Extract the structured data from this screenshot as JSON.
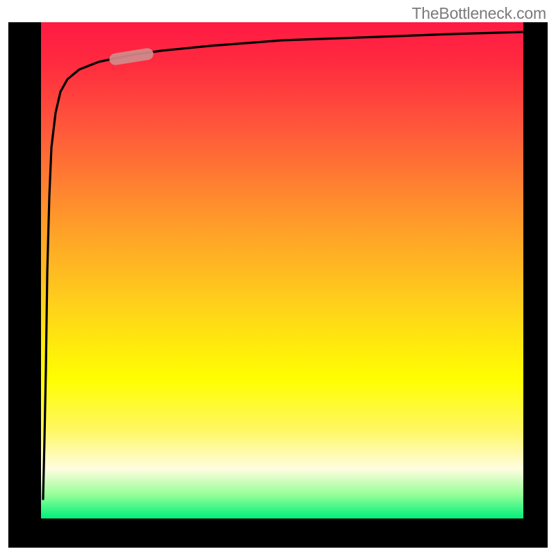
{
  "watermark": {
    "text": "TheBottleneck.com"
  },
  "chart_data": {
    "type": "line",
    "title": "",
    "xlabel": "",
    "ylabel": "",
    "xlim": [
      0,
      100
    ],
    "ylim": [
      0,
      100
    ],
    "grid": false,
    "legend": false,
    "background_gradient": {
      "direction": "vertical",
      "stops": [
        {
          "pos": 0.0,
          "color": "#ff1a44"
        },
        {
          "pos": 0.4,
          "color": "#ff9a2a"
        },
        {
          "pos": 0.72,
          "color": "#ffff00"
        },
        {
          "pos": 0.9,
          "color": "#fffde0"
        },
        {
          "pos": 1.0,
          "color": "#00f07a"
        }
      ]
    },
    "series": [
      {
        "name": "curve",
        "color": "#000000",
        "x": [
          0.5,
          0.8,
          1.0,
          1.3,
          1.7,
          2.2,
          3.0,
          4.0,
          5.5,
          8.0,
          12.0,
          18.0,
          25.0,
          35.0,
          50.0,
          70.0,
          85.0,
          100.0
        ],
        "y": [
          4.0,
          12.0,
          30.0,
          50.0,
          65.0,
          75.0,
          82.0,
          86.0,
          88.5,
          90.5,
          92.0,
          93.2,
          94.2,
          95.2,
          96.3,
          97.1,
          97.6,
          98.0
        ]
      }
    ],
    "annotations": [
      {
        "name": "pill-marker",
        "shape": "rounded-segment",
        "color": "#d28b8b",
        "x_range": [
          14.5,
          22.5
        ],
        "y_range": [
          92.5,
          94.0
        ]
      }
    ]
  }
}
